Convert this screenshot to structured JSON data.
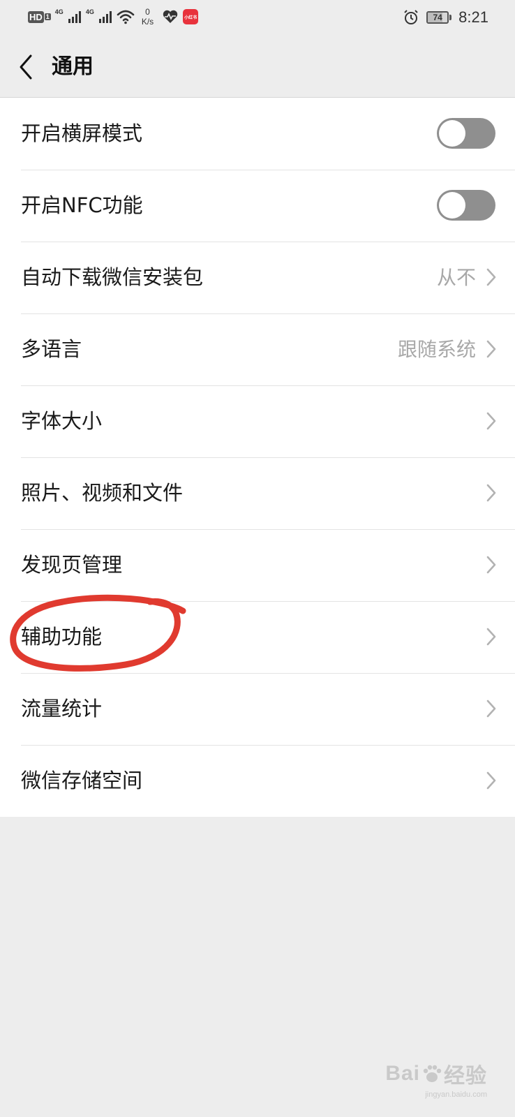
{
  "status_bar": {
    "hd": "HD",
    "sim": "1",
    "net1": "4G",
    "net2": "4G",
    "speed_value": "0",
    "speed_unit": "K/s",
    "app_badge": "小红书",
    "battery": "74",
    "battery_level": 0.74,
    "time": "8:21"
  },
  "nav": {
    "title": "通用"
  },
  "rows": [
    {
      "label": "开启横屏模式",
      "type": "toggle",
      "on": false
    },
    {
      "label": "开启NFC功能",
      "type": "toggle",
      "on": false
    },
    {
      "label": "自动下载微信安装包",
      "type": "link",
      "value": "从不"
    },
    {
      "label": "多语言",
      "type": "link",
      "value": "跟随系统"
    },
    {
      "label": "字体大小",
      "type": "link"
    },
    {
      "label": "照片、视频和文件",
      "type": "link"
    },
    {
      "label": "发现页管理",
      "type": "link"
    },
    {
      "label": "辅助功能",
      "type": "link"
    },
    {
      "label": "流量统计",
      "type": "link"
    },
    {
      "label": "微信存储空间",
      "type": "link"
    }
  ],
  "annotation": {
    "color": "#e03a2f",
    "target": "辅助功能"
  },
  "watermark": {
    "brand": "Bai",
    "suffix": "经验",
    "url": "jingyan.baidu.com"
  }
}
